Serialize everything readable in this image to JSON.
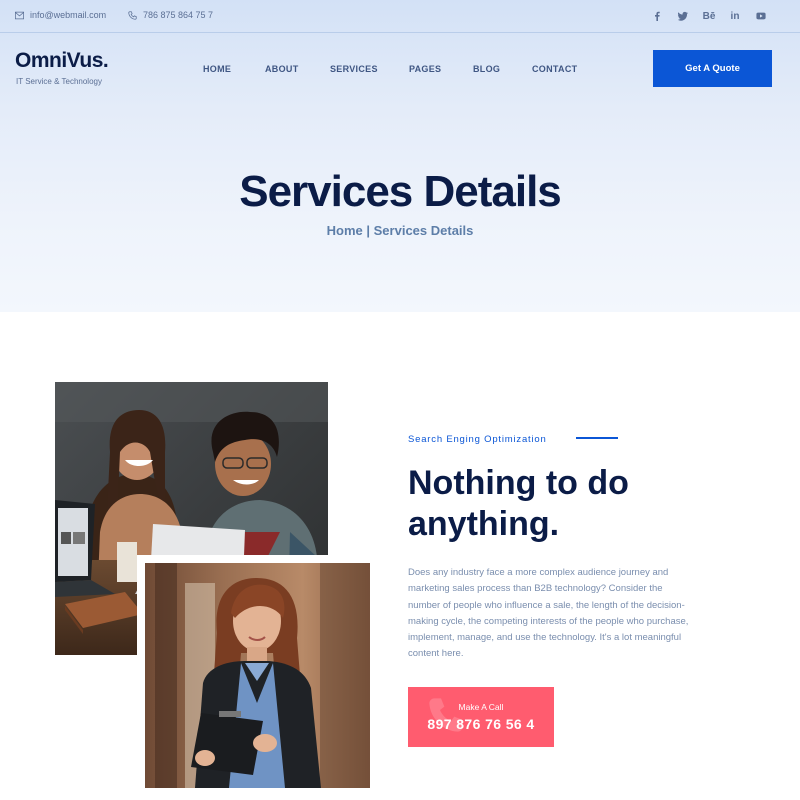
{
  "topbar": {
    "email": "info@webmail.com",
    "phone": "786 875 864 75 7",
    "socials": [
      {
        "icon": "facebook-icon",
        "glyph": "f"
      },
      {
        "icon": "twitter-icon",
        "glyph": ""
      },
      {
        "icon": "behance-icon",
        "glyph": "Bē"
      },
      {
        "icon": "linkedin-icon",
        "glyph": "in"
      },
      {
        "icon": "youtube-icon",
        "glyph": ""
      }
    ]
  },
  "brand": {
    "name": "OmniVus.",
    "tagline": "IT Service & Technology"
  },
  "nav": {
    "items": [
      "HOME",
      "ABOUT",
      "SERVICES",
      "PAGES",
      "BLOG",
      "CONTACT"
    ],
    "cta": "Get A Quote"
  },
  "hero": {
    "title": "Services Details",
    "breadcrumb": {
      "home": "Home",
      "separator": "|",
      "current": "Services Details"
    }
  },
  "content": {
    "kicker": "Search Enging Optimization",
    "headline": "Nothing to do anything.",
    "paragraph": "Does any industry face a more complex audience journey and marketing sales process than B2B technology? Consider the number of people who influence a sale, the length of the decision-making cycle, the competing interests of the people who purchase, implement, manage, and use the technology. It's a lot meaningful content here.",
    "call": {
      "label": "Make A Call",
      "number": "897 876 76 56 4"
    }
  },
  "colors": {
    "primary": "#0b56d6",
    "dark": "#0b1c47",
    "accent": "#ff5c6f",
    "muted": "#7a8eae"
  }
}
